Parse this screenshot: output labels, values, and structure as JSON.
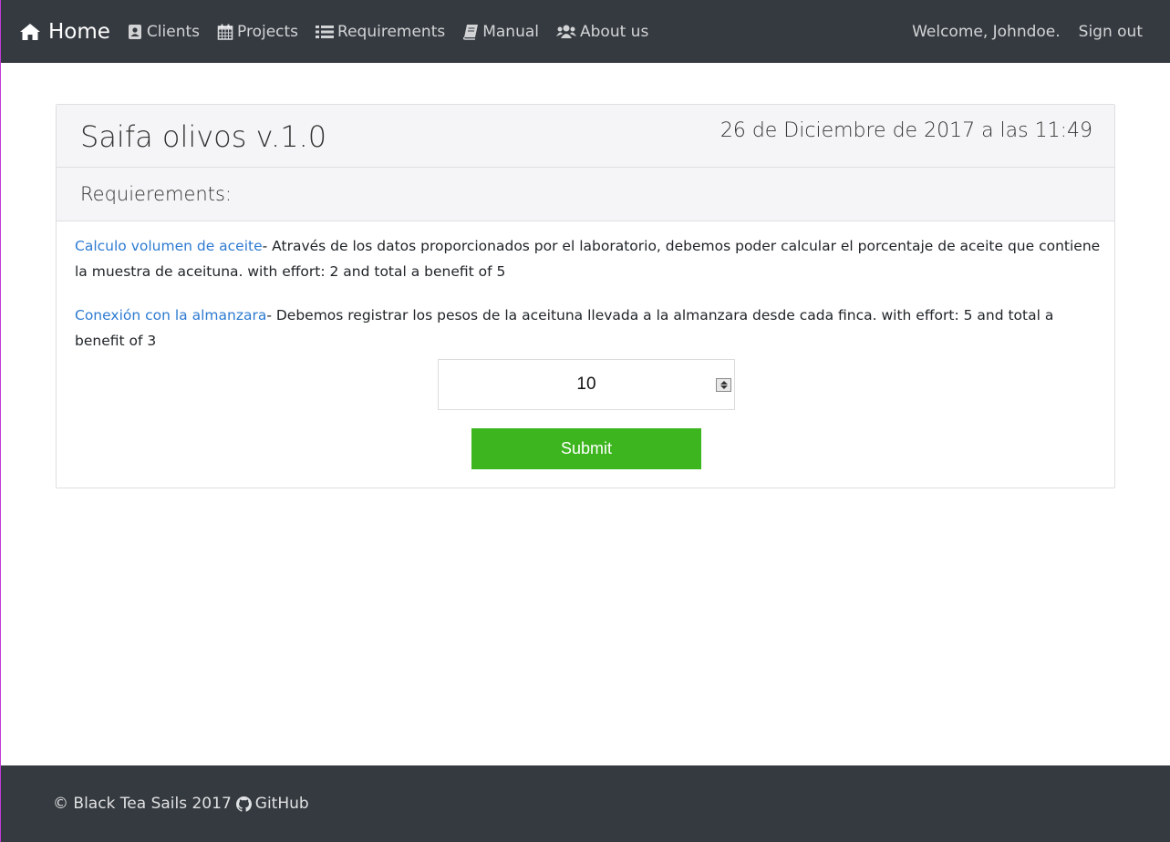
{
  "nav": {
    "brand_icon": "home-icon",
    "brand": "Home",
    "items": [
      {
        "label": "Clients",
        "icon": "address-card-icon"
      },
      {
        "label": "Projects",
        "icon": "calendar-icon"
      },
      {
        "label": "Requirements",
        "icon": "list-icon"
      },
      {
        "label": "Manual",
        "icon": "book-icon"
      },
      {
        "label": "About us",
        "icon": "users-icon"
      }
    ],
    "welcome": "Welcome, Johndoe.",
    "signout": "Sign out"
  },
  "project": {
    "title": "Saifa olivos v.1.0",
    "date": "26 de Diciembre de 2017 a las 11:49",
    "subtitle": "Requierements:"
  },
  "requirements": [
    {
      "name": "Calculo volumen de aceite",
      "description": "- Através de los datos proporcionados por el laboratorio, debemos poder calcular el porcentaje de aceite que contiene la muestra de aceituna. with effort: 2 and total a benefit of 5"
    },
    {
      "name": "Conexión con la almanzara",
      "description": "- Debemos registrar los pesos de la aceituna llevada a la almanzara desde cada finca. with effort: 5 and total a benefit of 3"
    }
  ],
  "form": {
    "number_value": "10",
    "submit_label": "Submit"
  },
  "footer": {
    "copyright": "© Black Tea Sails 2017",
    "github_icon": "github-icon",
    "github_label": "GitHub"
  },
  "colors": {
    "navbar": "#343a40",
    "link": "#2e7bd1",
    "submit": "#3db51f"
  }
}
